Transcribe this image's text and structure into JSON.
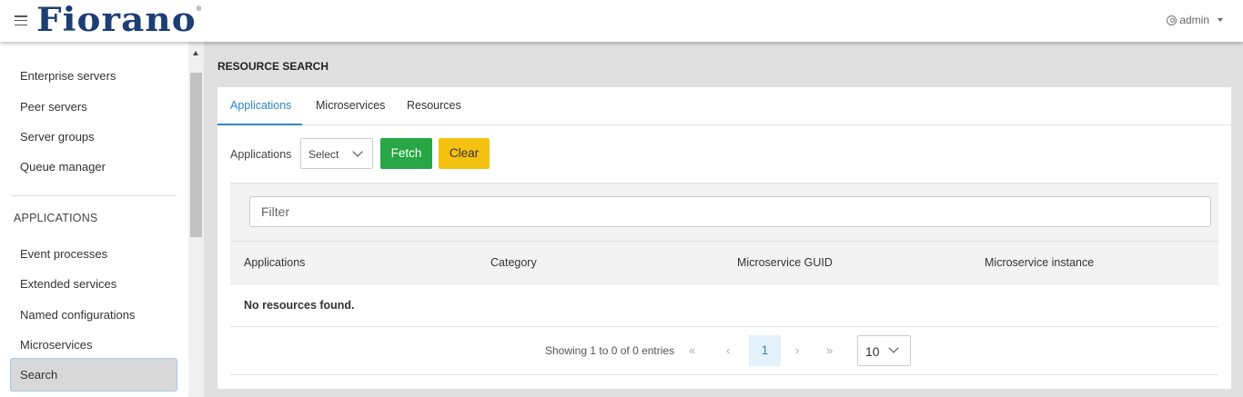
{
  "header": {
    "logo": "Fiorano",
    "logo_mark": "®",
    "user": "admin"
  },
  "sidebar": {
    "items_top": [
      "Enterprise servers",
      "Peer servers",
      "Server groups",
      "Queue manager"
    ],
    "section_title": "APPLICATIONS",
    "items_apps": [
      "Event processes",
      "Extended services",
      "Named configurations",
      "Microservices"
    ],
    "active_item": "Search"
  },
  "main": {
    "title": "RESOURCE SEARCH",
    "tabs": [
      {
        "label": "Applications",
        "active": true
      },
      {
        "label": "Microservices",
        "active": false
      },
      {
        "label": "Resources",
        "active": false
      }
    ],
    "field_label": "Applications",
    "select_value": "Select",
    "fetch_label": "Fetch",
    "clear_label": "Clear",
    "filter_placeholder": "Filter",
    "columns": [
      "Applications",
      "Category",
      "Microservice GUID",
      "Microservice instance"
    ],
    "empty_message": "No resources found.",
    "showing": "Showing 1 to 0 of 0 entries",
    "pager": {
      "first": "«",
      "prev": "‹",
      "current": "1",
      "next": "›",
      "last": "»"
    },
    "per_page": "10"
  },
  "colors": {
    "brand": "#1b3f74",
    "accent": "#2f86c9",
    "fetch": "#27a745",
    "clear": "#f5c110"
  }
}
